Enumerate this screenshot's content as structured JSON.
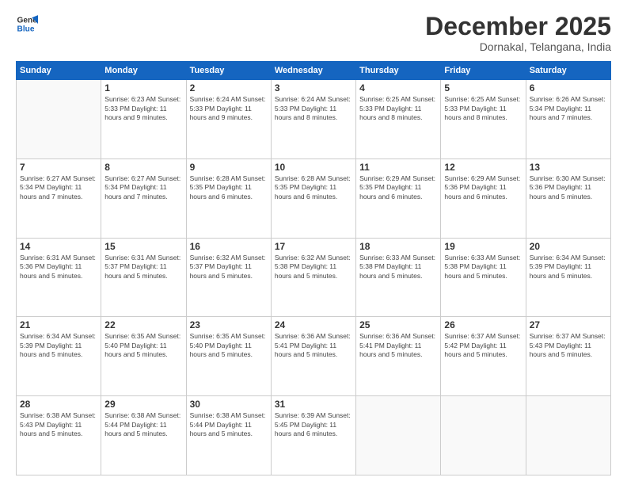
{
  "header": {
    "logo_line1": "General",
    "logo_line2": "Blue",
    "month": "December 2025",
    "location": "Dornakal, Telangana, India"
  },
  "weekdays": [
    "Sunday",
    "Monday",
    "Tuesday",
    "Wednesday",
    "Thursday",
    "Friday",
    "Saturday"
  ],
  "weeks": [
    [
      {
        "day": "",
        "info": ""
      },
      {
        "day": "1",
        "info": "Sunrise: 6:23 AM\nSunset: 5:33 PM\nDaylight: 11 hours\nand 9 minutes."
      },
      {
        "day": "2",
        "info": "Sunrise: 6:24 AM\nSunset: 5:33 PM\nDaylight: 11 hours\nand 9 minutes."
      },
      {
        "day": "3",
        "info": "Sunrise: 6:24 AM\nSunset: 5:33 PM\nDaylight: 11 hours\nand 8 minutes."
      },
      {
        "day": "4",
        "info": "Sunrise: 6:25 AM\nSunset: 5:33 PM\nDaylight: 11 hours\nand 8 minutes."
      },
      {
        "day": "5",
        "info": "Sunrise: 6:25 AM\nSunset: 5:33 PM\nDaylight: 11 hours\nand 8 minutes."
      },
      {
        "day": "6",
        "info": "Sunrise: 6:26 AM\nSunset: 5:34 PM\nDaylight: 11 hours\nand 7 minutes."
      }
    ],
    [
      {
        "day": "7",
        "info": "Sunrise: 6:27 AM\nSunset: 5:34 PM\nDaylight: 11 hours\nand 7 minutes."
      },
      {
        "day": "8",
        "info": "Sunrise: 6:27 AM\nSunset: 5:34 PM\nDaylight: 11 hours\nand 7 minutes."
      },
      {
        "day": "9",
        "info": "Sunrise: 6:28 AM\nSunset: 5:35 PM\nDaylight: 11 hours\nand 6 minutes."
      },
      {
        "day": "10",
        "info": "Sunrise: 6:28 AM\nSunset: 5:35 PM\nDaylight: 11 hours\nand 6 minutes."
      },
      {
        "day": "11",
        "info": "Sunrise: 6:29 AM\nSunset: 5:35 PM\nDaylight: 11 hours\nand 6 minutes."
      },
      {
        "day": "12",
        "info": "Sunrise: 6:29 AM\nSunset: 5:36 PM\nDaylight: 11 hours\nand 6 minutes."
      },
      {
        "day": "13",
        "info": "Sunrise: 6:30 AM\nSunset: 5:36 PM\nDaylight: 11 hours\nand 5 minutes."
      }
    ],
    [
      {
        "day": "14",
        "info": "Sunrise: 6:31 AM\nSunset: 5:36 PM\nDaylight: 11 hours\nand 5 minutes."
      },
      {
        "day": "15",
        "info": "Sunrise: 6:31 AM\nSunset: 5:37 PM\nDaylight: 11 hours\nand 5 minutes."
      },
      {
        "day": "16",
        "info": "Sunrise: 6:32 AM\nSunset: 5:37 PM\nDaylight: 11 hours\nand 5 minutes."
      },
      {
        "day": "17",
        "info": "Sunrise: 6:32 AM\nSunset: 5:38 PM\nDaylight: 11 hours\nand 5 minutes."
      },
      {
        "day": "18",
        "info": "Sunrise: 6:33 AM\nSunset: 5:38 PM\nDaylight: 11 hours\nand 5 minutes."
      },
      {
        "day": "19",
        "info": "Sunrise: 6:33 AM\nSunset: 5:38 PM\nDaylight: 11 hours\nand 5 minutes."
      },
      {
        "day": "20",
        "info": "Sunrise: 6:34 AM\nSunset: 5:39 PM\nDaylight: 11 hours\nand 5 minutes."
      }
    ],
    [
      {
        "day": "21",
        "info": "Sunrise: 6:34 AM\nSunset: 5:39 PM\nDaylight: 11 hours\nand 5 minutes."
      },
      {
        "day": "22",
        "info": "Sunrise: 6:35 AM\nSunset: 5:40 PM\nDaylight: 11 hours\nand 5 minutes."
      },
      {
        "day": "23",
        "info": "Sunrise: 6:35 AM\nSunset: 5:40 PM\nDaylight: 11 hours\nand 5 minutes."
      },
      {
        "day": "24",
        "info": "Sunrise: 6:36 AM\nSunset: 5:41 PM\nDaylight: 11 hours\nand 5 minutes."
      },
      {
        "day": "25",
        "info": "Sunrise: 6:36 AM\nSunset: 5:41 PM\nDaylight: 11 hours\nand 5 minutes."
      },
      {
        "day": "26",
        "info": "Sunrise: 6:37 AM\nSunset: 5:42 PM\nDaylight: 11 hours\nand 5 minutes."
      },
      {
        "day": "27",
        "info": "Sunrise: 6:37 AM\nSunset: 5:43 PM\nDaylight: 11 hours\nand 5 minutes."
      }
    ],
    [
      {
        "day": "28",
        "info": "Sunrise: 6:38 AM\nSunset: 5:43 PM\nDaylight: 11 hours\nand 5 minutes."
      },
      {
        "day": "29",
        "info": "Sunrise: 6:38 AM\nSunset: 5:44 PM\nDaylight: 11 hours\nand 5 minutes."
      },
      {
        "day": "30",
        "info": "Sunrise: 6:38 AM\nSunset: 5:44 PM\nDaylight: 11 hours\nand 5 minutes."
      },
      {
        "day": "31",
        "info": "Sunrise: 6:39 AM\nSunset: 5:45 PM\nDaylight: 11 hours\nand 6 minutes."
      },
      {
        "day": "",
        "info": ""
      },
      {
        "day": "",
        "info": ""
      },
      {
        "day": "",
        "info": ""
      }
    ]
  ]
}
